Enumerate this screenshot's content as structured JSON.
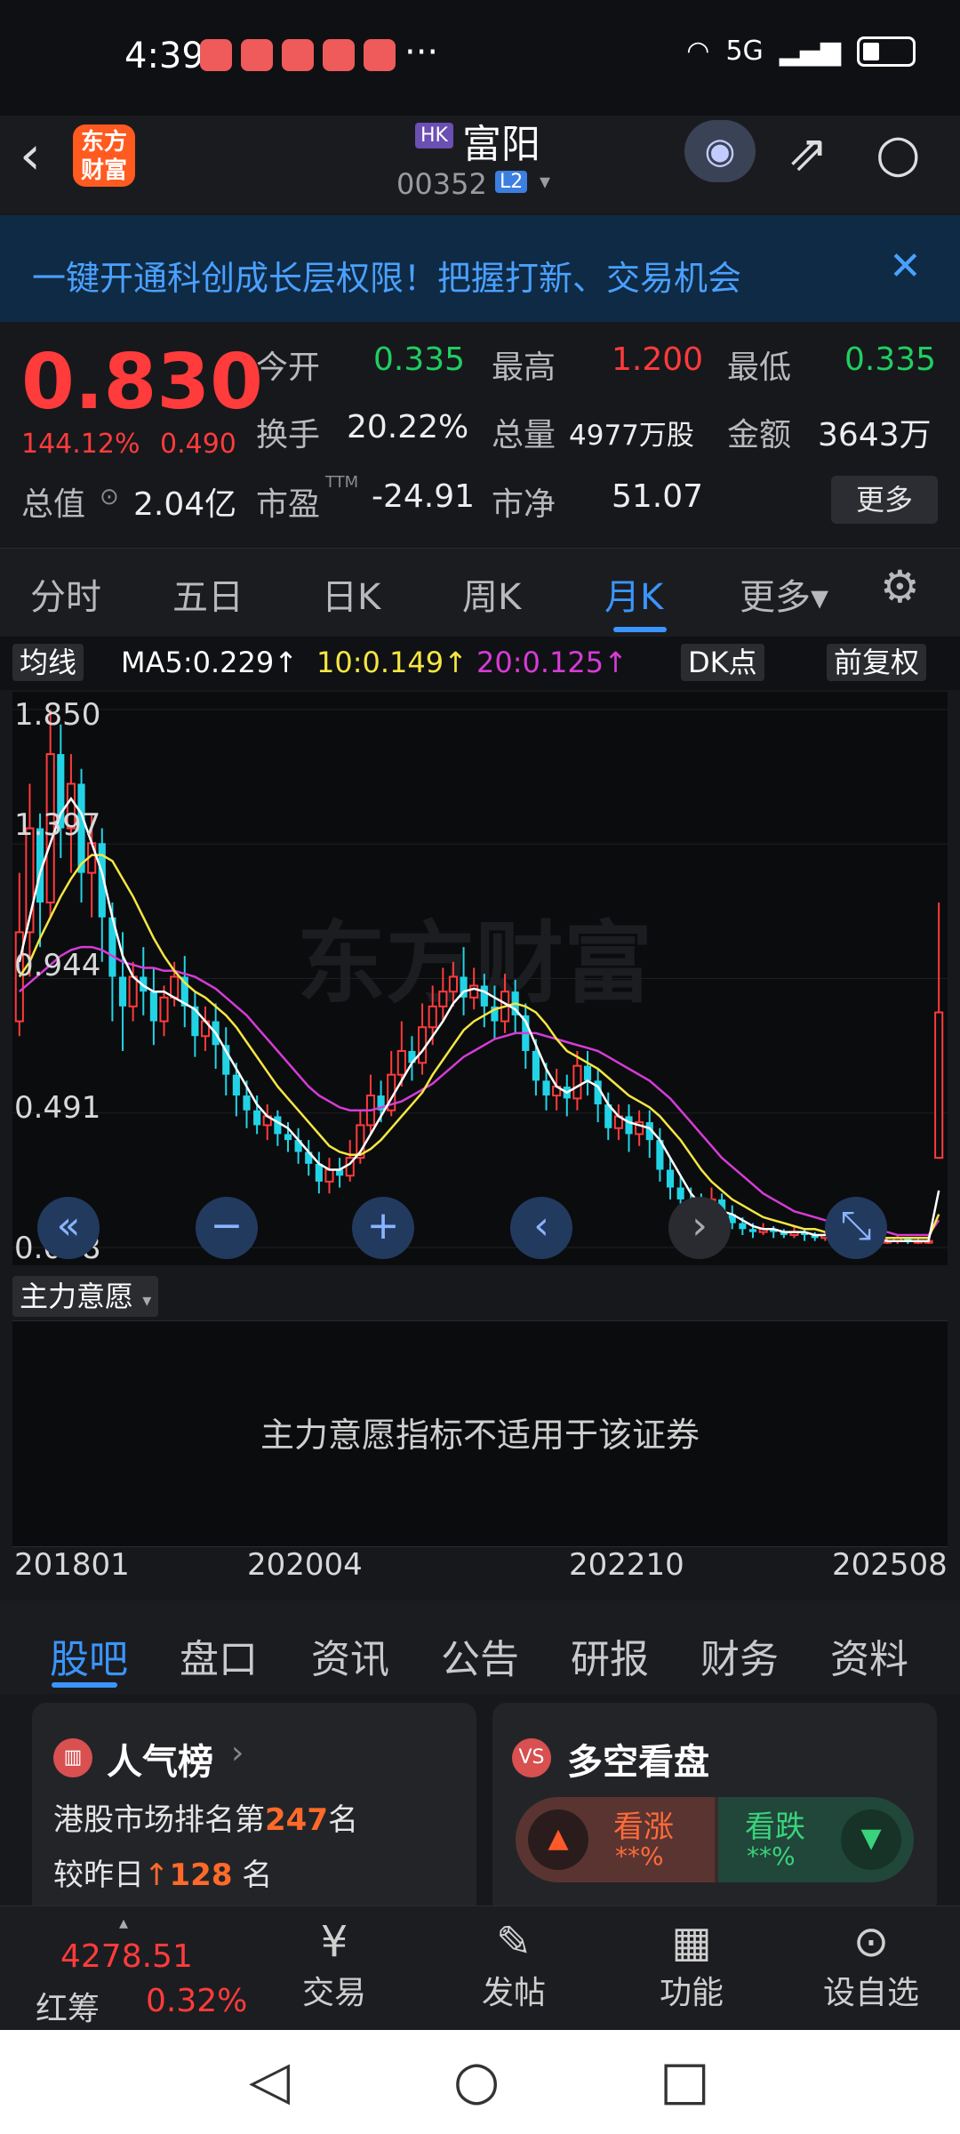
{
  "status_bar": {
    "time": "4:39",
    "dots": "···",
    "network": "5G"
  },
  "header": {
    "logo_text": "东方财富",
    "market_badge": "HK",
    "stock_name": "富阳",
    "stock_code": "00352",
    "level_badge": "L2"
  },
  "banner": {
    "text": "一键开通科创成长层权限！把握打新、交易机会"
  },
  "quote": {
    "price": "0.830",
    "change_pct": "144.12%",
    "change_amt": "0.490",
    "open_label": "今开",
    "open": "0.335",
    "high_label": "最高",
    "high": "1.200",
    "low_label": "最低",
    "low": "0.335",
    "turnover_label": "换手",
    "turnover": "20.22%",
    "volume_label": "总量",
    "volume": "4977万股",
    "amount_label": "金额",
    "amount": "3643万",
    "mktcap_label": "总值",
    "mktcap": "2.04亿",
    "pe_label": "市盈",
    "pe_sup": "TTM",
    "pe": "-24.91",
    "pb_label": "市净",
    "pb": "51.07",
    "more_label": "更多"
  },
  "ktabs": [
    "分时",
    "五日",
    "日K",
    "周K",
    "月K",
    "更多▾"
  ],
  "ma_bar": {
    "btn": "均线",
    "ma5": "MA5:0.229↑",
    "ma10": "10:0.149↑",
    "ma20": "20:0.125↑",
    "dk": "DK点",
    "fq": "前复权"
  },
  "chart_data": {
    "type": "candlestick",
    "y_ticks": [
      "1.850",
      "1.397",
      "0.944",
      "0.491",
      "0.038"
    ],
    "ylim": [
      0.038,
      1.85
    ],
    "x_ticks": [
      "201801",
      "202004",
      "202210",
      "202508"
    ],
    "watermark": "东方财富",
    "candles": [
      [
        0.8,
        1.1,
        0.75,
        1.3
      ],
      [
        1.1,
        1.45,
        0.95,
        1.6
      ],
      [
        1.45,
        1.2,
        1.05,
        1.5
      ],
      [
        1.2,
        1.7,
        1.15,
        1.85
      ],
      [
        1.7,
        1.45,
        1.35,
        1.8
      ],
      [
        1.45,
        1.6,
        1.3,
        1.7
      ],
      [
        1.6,
        1.3,
        1.2,
        1.65
      ],
      [
        1.3,
        1.4,
        1.15,
        1.5
      ],
      [
        1.4,
        1.15,
        1.0,
        1.45
      ],
      [
        1.15,
        0.95,
        0.8,
        1.2
      ],
      [
        0.95,
        0.85,
        0.7,
        1.1
      ],
      [
        0.85,
        0.95,
        0.8,
        1.0
      ],
      [
        0.95,
        0.9,
        0.82,
        1.05
      ],
      [
        0.9,
        0.8,
        0.72,
        0.98
      ],
      [
        0.8,
        0.88,
        0.75,
        0.92
      ],
      [
        0.88,
        0.95,
        0.85,
        1.0
      ],
      [
        0.95,
        0.85,
        0.78,
        1.02
      ],
      [
        0.85,
        0.75,
        0.68,
        0.9
      ],
      [
        0.75,
        0.8,
        0.7,
        0.85
      ],
      [
        0.8,
        0.72,
        0.64,
        0.86
      ],
      [
        0.72,
        0.62,
        0.55,
        0.78
      ],
      [
        0.62,
        0.55,
        0.48,
        0.66
      ],
      [
        0.55,
        0.5,
        0.44,
        0.6
      ],
      [
        0.5,
        0.45,
        0.42,
        0.55
      ],
      [
        0.45,
        0.48,
        0.4,
        0.52
      ],
      [
        0.48,
        0.42,
        0.38,
        0.5
      ],
      [
        0.42,
        0.4,
        0.36,
        0.46
      ],
      [
        0.4,
        0.36,
        0.32,
        0.44
      ],
      [
        0.36,
        0.32,
        0.28,
        0.4
      ],
      [
        0.32,
        0.26,
        0.22,
        0.36
      ],
      [
        0.26,
        0.3,
        0.22,
        0.34
      ],
      [
        0.3,
        0.28,
        0.24,
        0.34
      ],
      [
        0.28,
        0.34,
        0.26,
        0.4
      ],
      [
        0.34,
        0.45,
        0.32,
        0.5
      ],
      [
        0.45,
        0.55,
        0.42,
        0.62
      ],
      [
        0.55,
        0.5,
        0.46,
        0.6
      ],
      [
        0.5,
        0.62,
        0.48,
        0.7
      ],
      [
        0.62,
        0.7,
        0.58,
        0.8
      ],
      [
        0.7,
        0.66,
        0.6,
        0.75
      ],
      [
        0.66,
        0.78,
        0.62,
        0.86
      ],
      [
        0.78,
        0.85,
        0.72,
        0.92
      ],
      [
        0.85,
        0.9,
        0.8,
        0.98
      ],
      [
        0.9,
        0.95,
        0.85,
        1.0
      ],
      [
        0.95,
        0.88,
        0.82,
        1.05
      ],
      [
        0.88,
        0.92,
        0.84,
        0.98
      ],
      [
        0.92,
        0.85,
        0.78,
        0.96
      ],
      [
        0.85,
        0.8,
        0.74,
        0.92
      ],
      [
        0.8,
        0.9,
        0.76,
        0.96
      ],
      [
        0.9,
        0.82,
        0.76,
        0.94
      ],
      [
        0.82,
        0.7,
        0.64,
        0.86
      ],
      [
        0.7,
        0.6,
        0.55,
        0.74
      ],
      [
        0.6,
        0.55,
        0.5,
        0.66
      ],
      [
        0.55,
        0.58,
        0.5,
        0.64
      ],
      [
        0.58,
        0.54,
        0.48,
        0.62
      ],
      [
        0.54,
        0.65,
        0.5,
        0.7
      ],
      [
        0.65,
        0.6,
        0.55,
        0.7
      ],
      [
        0.6,
        0.52,
        0.46,
        0.64
      ],
      [
        0.52,
        0.44,
        0.4,
        0.56
      ],
      [
        0.44,
        0.48,
        0.4,
        0.52
      ],
      [
        0.48,
        0.42,
        0.36,
        0.52
      ],
      [
        0.42,
        0.46,
        0.38,
        0.5
      ],
      [
        0.46,
        0.4,
        0.34,
        0.5
      ],
      [
        0.4,
        0.3,
        0.26,
        0.44
      ],
      [
        0.3,
        0.24,
        0.2,
        0.34
      ],
      [
        0.24,
        0.2,
        0.16,
        0.28
      ],
      [
        0.2,
        0.18,
        0.14,
        0.24
      ],
      [
        0.18,
        0.16,
        0.12,
        0.22
      ],
      [
        0.16,
        0.2,
        0.14,
        0.24
      ],
      [
        0.2,
        0.15,
        0.12,
        0.22
      ],
      [
        0.15,
        0.12,
        0.1,
        0.18
      ],
      [
        0.12,
        0.1,
        0.08,
        0.14
      ],
      [
        0.1,
        0.09,
        0.07,
        0.12
      ],
      [
        0.09,
        0.1,
        0.08,
        0.12
      ],
      [
        0.1,
        0.09,
        0.07,
        0.11
      ],
      [
        0.09,
        0.08,
        0.07,
        0.1
      ],
      [
        0.08,
        0.09,
        0.07,
        0.11
      ],
      [
        0.09,
        0.08,
        0.06,
        0.1
      ],
      [
        0.08,
        0.07,
        0.06,
        0.09
      ],
      [
        0.07,
        0.08,
        0.06,
        0.09
      ],
      [
        0.08,
        0.07,
        0.06,
        0.09
      ],
      [
        0.07,
        0.07,
        0.06,
        0.08
      ],
      [
        0.07,
        0.06,
        0.05,
        0.08
      ],
      [
        0.06,
        0.07,
        0.05,
        0.08
      ],
      [
        0.07,
        0.06,
        0.05,
        0.07
      ],
      [
        0.06,
        0.06,
        0.05,
        0.07
      ],
      [
        0.06,
        0.07,
        0.05,
        0.08
      ],
      [
        0.07,
        0.06,
        0.05,
        0.07
      ],
      [
        0.06,
        0.06,
        0.05,
        0.07
      ],
      [
        0.06,
        0.06,
        0.05,
        0.07
      ],
      [
        0.34,
        0.83,
        0.34,
        1.2
      ]
    ],
    "ma5": [
      1.0,
      1.15,
      1.3,
      1.4,
      1.5,
      1.55,
      1.5,
      1.4,
      1.3,
      1.15,
      1.02,
      0.95,
      0.92,
      0.9,
      0.9,
      0.88,
      0.86,
      0.84,
      0.8,
      0.76,
      0.7,
      0.64,
      0.58,
      0.52,
      0.48,
      0.46,
      0.44,
      0.4,
      0.36,
      0.32,
      0.3,
      0.3,
      0.32,
      0.36,
      0.42,
      0.48,
      0.54,
      0.6,
      0.66,
      0.7,
      0.75,
      0.8,
      0.86,
      0.9,
      0.91,
      0.9,
      0.88,
      0.86,
      0.84,
      0.8,
      0.72,
      0.64,
      0.58,
      0.56,
      0.58,
      0.6,
      0.58,
      0.52,
      0.48,
      0.46,
      0.45,
      0.44,
      0.4,
      0.34,
      0.28,
      0.22,
      0.18,
      0.17,
      0.16,
      0.15,
      0.13,
      0.11,
      0.1,
      0.1,
      0.09,
      0.09,
      0.09,
      0.08,
      0.08,
      0.08,
      0.07,
      0.07,
      0.07,
      0.07,
      0.06,
      0.06,
      0.06,
      0.06,
      0.06,
      0.23
    ],
    "ma10": [
      0.95,
      1.0,
      1.08,
      1.15,
      1.22,
      1.28,
      1.33,
      1.36,
      1.36,
      1.34,
      1.28,
      1.22,
      1.15,
      1.08,
      1.02,
      0.97,
      0.93,
      0.9,
      0.88,
      0.85,
      0.82,
      0.78,
      0.73,
      0.68,
      0.63,
      0.58,
      0.54,
      0.5,
      0.46,
      0.42,
      0.38,
      0.36,
      0.35,
      0.35,
      0.37,
      0.4,
      0.44,
      0.48,
      0.52,
      0.56,
      0.62,
      0.67,
      0.72,
      0.77,
      0.8,
      0.82,
      0.84,
      0.85,
      0.86,
      0.85,
      0.83,
      0.79,
      0.74,
      0.7,
      0.68,
      0.66,
      0.64,
      0.61,
      0.58,
      0.55,
      0.53,
      0.51,
      0.48,
      0.44,
      0.4,
      0.35,
      0.3,
      0.26,
      0.23,
      0.2,
      0.18,
      0.16,
      0.14,
      0.13,
      0.12,
      0.11,
      0.1,
      0.1,
      0.09,
      0.09,
      0.08,
      0.08,
      0.08,
      0.07,
      0.07,
      0.07,
      0.07,
      0.07,
      0.07,
      0.15
    ],
    "ma20": [
      0.9,
      0.93,
      0.96,
      0.99,
      1.02,
      1.04,
      1.05,
      1.05,
      1.04,
      1.02,
      1.0,
      0.99,
      0.98,
      0.98,
      0.97,
      0.97,
      0.96,
      0.95,
      0.93,
      0.91,
      0.88,
      0.85,
      0.82,
      0.78,
      0.74,
      0.7,
      0.66,
      0.62,
      0.58,
      0.55,
      0.53,
      0.51,
      0.5,
      0.5,
      0.5,
      0.51,
      0.52,
      0.53,
      0.55,
      0.57,
      0.59,
      0.62,
      0.65,
      0.68,
      0.7,
      0.72,
      0.74,
      0.75,
      0.76,
      0.76,
      0.76,
      0.75,
      0.74,
      0.73,
      0.72,
      0.71,
      0.7,
      0.68,
      0.66,
      0.64,
      0.62,
      0.6,
      0.57,
      0.54,
      0.5,
      0.46,
      0.42,
      0.38,
      0.34,
      0.31,
      0.28,
      0.25,
      0.22,
      0.2,
      0.18,
      0.16,
      0.15,
      0.14,
      0.13,
      0.12,
      0.11,
      0.1,
      0.1,
      0.09,
      0.09,
      0.08,
      0.08,
      0.08,
      0.08,
      0.13
    ]
  },
  "sub_indicator": {
    "label": "主力意愿",
    "message": "主力意愿指标不适用于该证券"
  },
  "info_tabs": [
    "股吧",
    "盘口",
    "资讯",
    "公告",
    "研报",
    "财务",
    "资料"
  ],
  "card_left": {
    "title": "人气榜",
    "line1_prefix": "港股市场排名第",
    "line1_value": "247",
    "line1_suffix": "名",
    "line2_prefix": "较昨日",
    "line2_value": "128",
    "line2_suffix": "名"
  },
  "card_right": {
    "title": "多空看盘",
    "up_label": "看涨",
    "up_value": "**%",
    "down_label": "看跌",
    "down_value": "**%"
  },
  "bottom_nav": {
    "index_value": "4278.51",
    "index_name": "红筹",
    "index_pct": "0.32%",
    "items": [
      "交易",
      "发帖",
      "功能",
      "设自选"
    ]
  }
}
